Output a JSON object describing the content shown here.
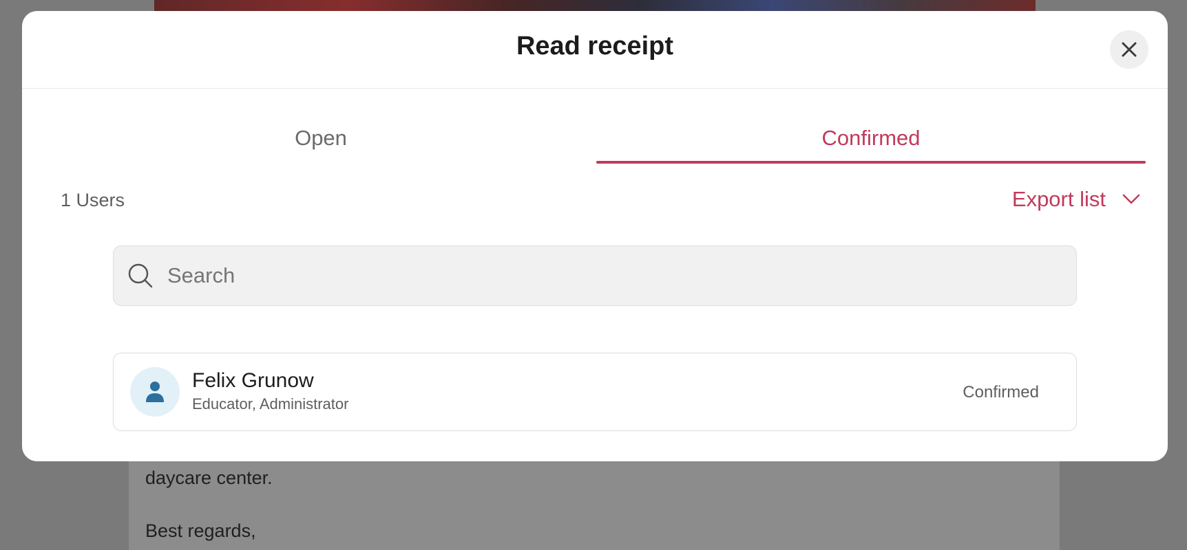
{
  "background": {
    "line1": "daycare center.",
    "line2": "Best regards,"
  },
  "modal": {
    "title": "Read receipt",
    "close_icon": "close-icon"
  },
  "tabs": [
    {
      "label": "Open",
      "active": false
    },
    {
      "label": "Confirmed",
      "active": true
    }
  ],
  "list": {
    "count_label": "1 Users",
    "export_label": "Export list",
    "search_placeholder": "Search",
    "users": [
      {
        "name": "Felix Grunow",
        "roles": "Educator, Administrator",
        "status": "Confirmed"
      }
    ]
  },
  "colors": {
    "accent": "#c13a5a",
    "avatar_bg": "#e2f0f8",
    "avatar_icon": "#2a6f9e"
  }
}
